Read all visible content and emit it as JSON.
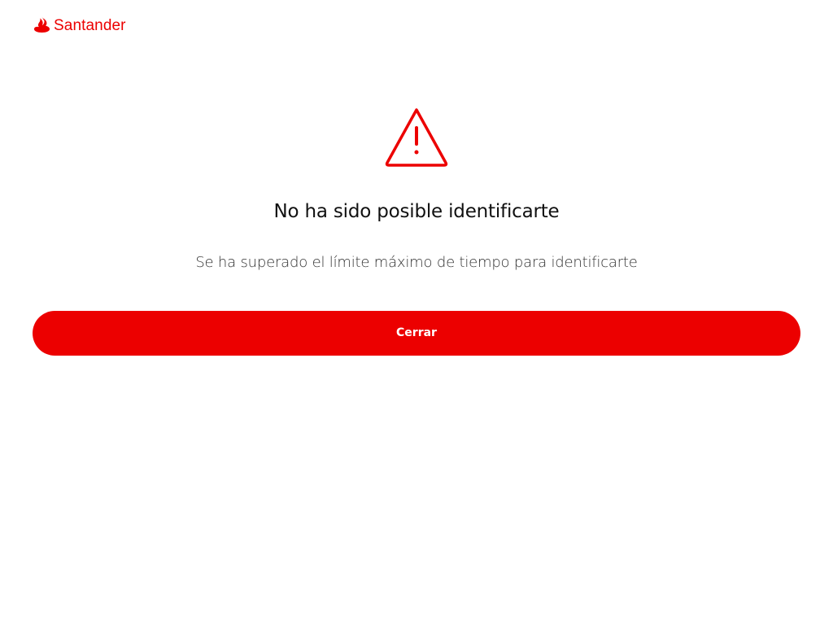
{
  "header": {
    "brand": "Santander",
    "logo_icon": "santander-flame-icon",
    "brand_color": "#ec0000"
  },
  "main": {
    "icon": "warning-triangle-icon",
    "title": "No ha sido posible identificarte",
    "message": "Se ha superado el límite máximo de tiempo para identificarte",
    "close_button_label": "Cerrar"
  },
  "colors": {
    "accent": "#ec0000",
    "background": "#ffffff",
    "title_text": "#111111",
    "body_text": "#333333",
    "button_text": "#ffffff"
  }
}
